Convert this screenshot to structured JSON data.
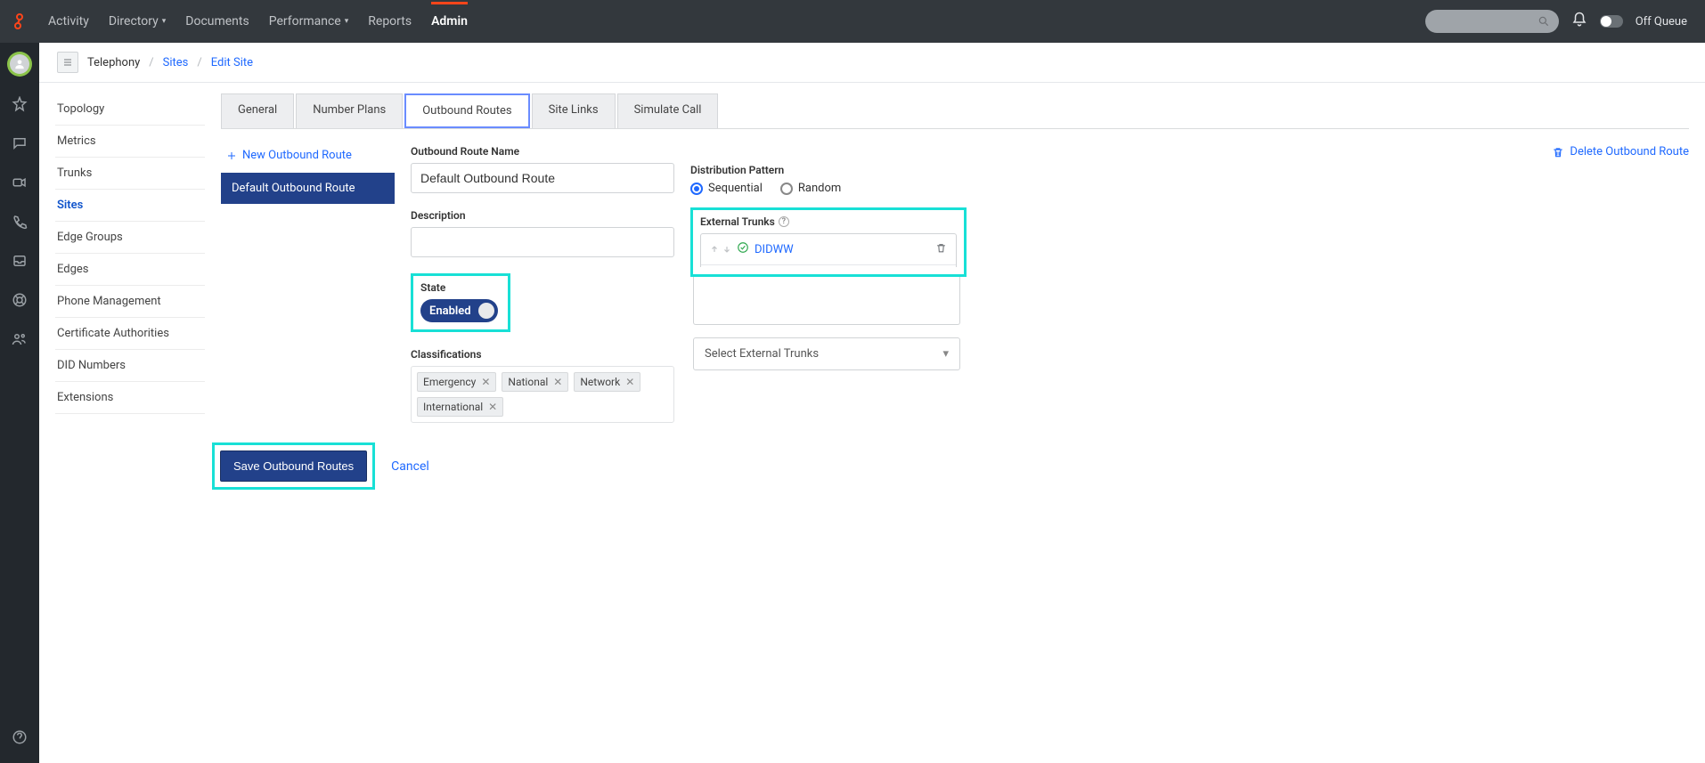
{
  "topbar": {
    "nav": {
      "activity": "Activity",
      "directory": "Directory",
      "documents": "Documents",
      "performance": "Performance",
      "reports": "Reports",
      "admin": "Admin"
    },
    "off_queue": "Off Queue"
  },
  "breadcrumb": {
    "root": "Telephony",
    "sites": "Sites",
    "edit": "Edit Site"
  },
  "side_nav": {
    "items": [
      "Topology",
      "Metrics",
      "Trunks",
      "Sites",
      "Edge Groups",
      "Edges",
      "Phone Management",
      "Certificate Authorities",
      "DID Numbers",
      "Extensions"
    ],
    "active_index": 3
  },
  "tabs": {
    "items": [
      "General",
      "Number Plans",
      "Outbound Routes",
      "Site Links",
      "Simulate Call"
    ],
    "active_index": 2
  },
  "routes": {
    "new_label": "New Outbound Route",
    "items": [
      "Default Outbound Route"
    ],
    "selected_index": 0
  },
  "form": {
    "name_label": "Outbound Route Name",
    "name_value": "Default Outbound Route",
    "desc_label": "Description",
    "desc_value": "",
    "state_label": "State",
    "state_enabled_text": "Enabled",
    "class_label": "Classifications",
    "classifications": [
      "Emergency",
      "National",
      "Network",
      "International"
    ]
  },
  "right": {
    "delete_label": "Delete Outbound Route",
    "dist_label": "Distribution Pattern",
    "dist_sequential": "Sequential",
    "dist_random": "Random",
    "dist_selected": "sequential",
    "ext_trunks_label": "External Trunks",
    "trunks": [
      {
        "name": "DIDWW"
      }
    ],
    "select_trunks_placeholder": "Select External Trunks"
  },
  "actions": {
    "save": "Save Outbound Routes",
    "cancel": "Cancel"
  }
}
